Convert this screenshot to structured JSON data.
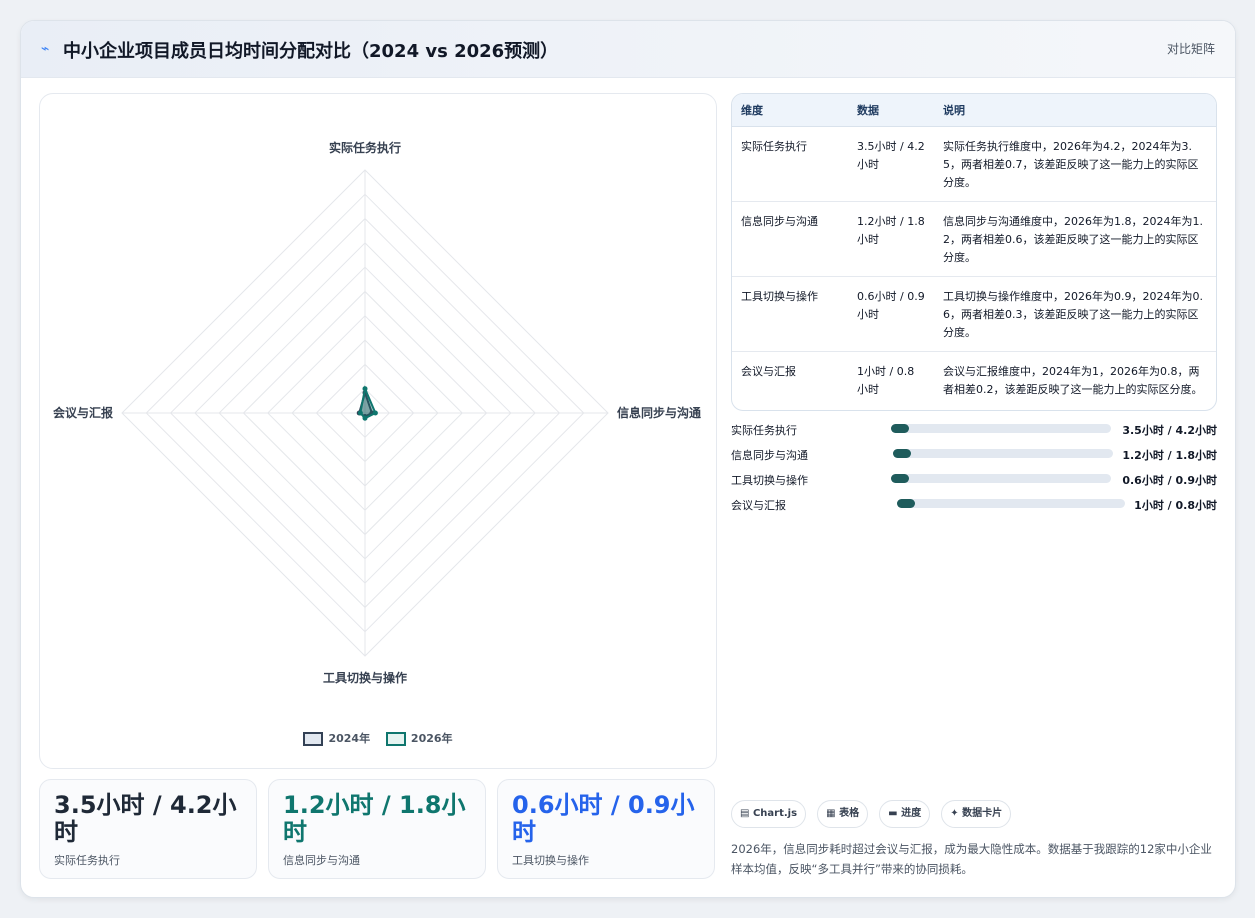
{
  "header": {
    "icon": "chart-icon",
    "title": "中小企业项目成员日均时间分配对比（2024 vs 2026预测）",
    "tag": "对比矩阵"
  },
  "chart_data": {
    "type": "radar",
    "axes": [
      "实际任务执行",
      "信息同步与沟通",
      "工具切换与操作",
      "会议与汇报"
    ],
    "series": [
      {
        "name": "2024年",
        "values": [
          3.5,
          1.2,
          0.6,
          1
        ],
        "color": "#334155"
      },
      {
        "name": "2026年",
        "values": [
          4.2,
          1.8,
          0.9,
          0.8
        ],
        "color": "#0f766e"
      }
    ],
    "grid": true,
    "legend_position": "bottom"
  },
  "kpis": [
    {
      "value": "3.5小时 / 4.2小时",
      "label": "实际任务执行",
      "color": "#1f2937"
    },
    {
      "value": "1.2小时 / 1.8小时",
      "label": "信息同步与沟通",
      "color": "#0f766e"
    },
    {
      "value": "0.6小时 / 0.9小时",
      "label": "工具切换与操作",
      "color": "#2563eb"
    }
  ],
  "table": {
    "headers": [
      "维度",
      "数据",
      "说明"
    ],
    "rows": [
      [
        "实际任务执行",
        "3.5小时 / 4.2小时",
        "实际任务执行维度中，2026年为4.2，2024年为3.5，两者相差0.7，该差距反映了这一能力上的实际区分度。"
      ],
      [
        "信息同步与沟通",
        "1.2小时 / 1.8小时",
        "信息同步与沟通维度中，2026年为1.8，2024年为1.2，两者相差0.6，该差距反映了这一能力上的实际区分度。"
      ],
      [
        "工具切换与操作",
        "0.6小时 / 0.9小时",
        "工具切换与操作维度中，2026年为0.9，2024年为0.6，两者相差0.3，该差距反映了这一能力上的实际区分度。"
      ],
      [
        "会议与汇报",
        "1小时 / 0.8小时",
        "会议与汇报维度中，2024年为1，2026年为0.8，两者相差0.2，该差距反映了这一能力上的实际区分度。"
      ]
    ]
  },
  "progress": [
    {
      "label": "实际任务执行",
      "value": "3.5小时 / 4.2小时",
      "fraction": 0.08
    },
    {
      "label": "信息同步与沟通",
      "value": "1.2小时 / 1.8小时",
      "fraction": 0.08
    },
    {
      "label": "工具切换与操作",
      "value": "0.6小时 / 0.9小时",
      "fraction": 0.08
    },
    {
      "label": "会议与汇报",
      "value": "1小时 / 0.8小时",
      "fraction": 0.08
    }
  ],
  "chips": [
    {
      "icon": "chart-icon",
      "label": "Chart.js"
    },
    {
      "icon": "table-icon",
      "label": "表格"
    },
    {
      "icon": "progress-icon",
      "label": "进度"
    },
    {
      "icon": "sparkle-icon",
      "label": "数据卡片"
    }
  ],
  "note": "2026年，信息同步耗时超过会议与汇报，成为最大隐性成本。数据基于我跟踪的12家中小企业样本均值，反映“多工具并行”带来的协同损耗。"
}
